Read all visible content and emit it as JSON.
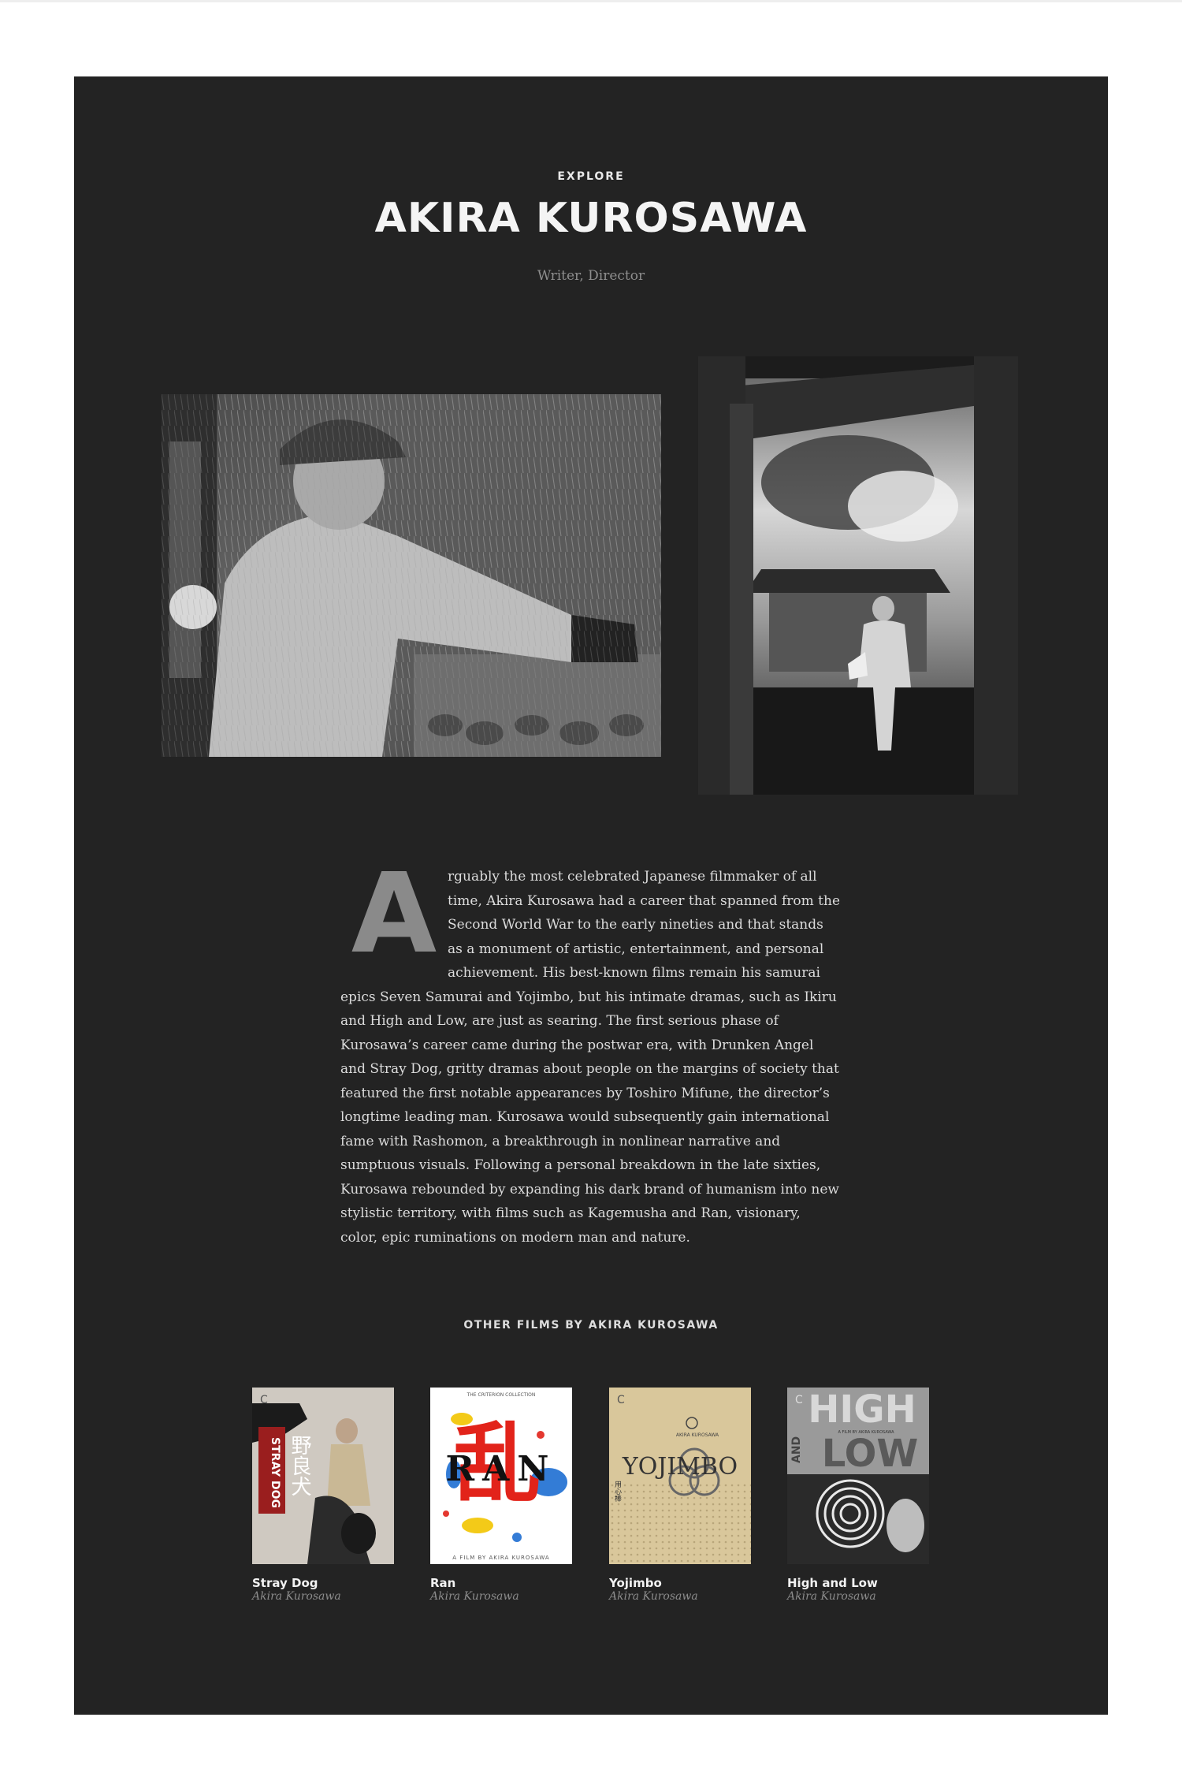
{
  "header": {
    "eyebrow": "EXPLORE",
    "name": "AKIRA KUROSAWA",
    "roles": "Writer, Director"
  },
  "photos": [
    {
      "icon": "director-on-set-photo"
    },
    {
      "icon": "director-at-castle-gate-photo"
    }
  ],
  "bio": {
    "dropcap": "A",
    "text": "rguably the most celebrated Japanese filmmaker of all time, Akira Kurosawa had a career that spanned from the Second World War to the early nineties and that stands as a monument of artistic, entertainment, and personal achievement. His best-known films remain his samurai epics Seven Samurai and Yojimbo, but his intimate dramas, such as Ikiru and High and Low, are just as searing. The first serious phase of Kurosawa’s career came during the postwar era, with Drunken Angel and Stray Dog, gritty dramas about people on the margins of society that featured the first notable appearances by Toshiro Mifune, the director’s longtime leading man. Kurosawa would subsequently gain international fame with Rashomon, a breakthrough in nonlinear narrative and sumptuous visuals. Following a personal breakdown in the late sixties, Kurosawa rebounded by expanding his dark brand of humanism into new stylistic territory, with films such as Kagemusha and Ran, visionary, color, epic ruminations on modern man and nature."
  },
  "other_films": {
    "label": "OTHER FILMS BY AKIRA KUROSAWA",
    "items": [
      {
        "title": "Stray Dog",
        "director": "Akira Kurosawa",
        "cover_text": "STRAY DOG",
        "cover_kanji": "野良犬"
      },
      {
        "title": "Ran",
        "director": "Akira Kurosawa",
        "cover_text": "RAN",
        "cover_kanji": "乱",
        "cover_header": "THE CRITERION COLLECTION",
        "cover_footer": "A FILM BY AKIRA KUROSAWA"
      },
      {
        "title": "Yojimbo",
        "director": "Akira Kurosawa",
        "cover_text": "YOJIMBO",
        "cover_kanji": "用心棒",
        "cover_header": "AKIRA KUROSAWA"
      },
      {
        "title": "High and Low",
        "director": "Akira Kurosawa",
        "cover_text": "HIGH",
        "cover_text2": "LOW",
        "cover_text3": "AND",
        "cover_header": "A FILM BY AKIRA KUROSAWA"
      }
    ]
  },
  "colors": {
    "panel": "#232323",
    "dropcap": "#8a8a8a",
    "ran_red": "#e2231a",
    "cover_beige": "#d9c79b"
  }
}
